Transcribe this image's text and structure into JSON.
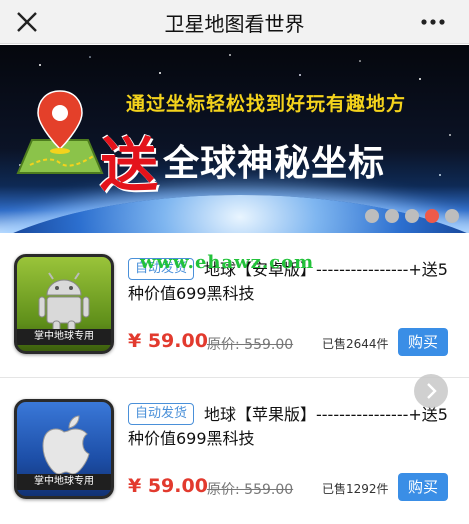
{
  "header": {
    "title": "卫星地图看世界",
    "close_icon": "close-icon",
    "more_icon": "more-dots-icon"
  },
  "banner": {
    "subtitle": "通过坐标轻松找到好玩有趣地方",
    "headline_highlight": "送",
    "headline_rest": "全球神秘坐标",
    "dots": 5,
    "active_dot": 4,
    "colors": {
      "highlight": "#e4131b",
      "subtitle": "#f4d31c",
      "active_dot": "#ee5a4a"
    }
  },
  "watermark": "www.ehawz.com",
  "products": [
    {
      "tag": "自动发货",
      "title": "地球【安卓版】----------------+送5种价值699黑科技",
      "thumb_label": "掌中地球专用",
      "price": "¥ 59.00",
      "original_price": "原价: 559.00",
      "sold": "已售2644件",
      "buy_label": "购买",
      "icon": "android-icon"
    },
    {
      "tag": "自动发货",
      "title": "地球【苹果版】----------------+送5种价值699黑科技",
      "thumb_label": "掌中地球专用",
      "price": "¥ 59.00",
      "original_price": "原价: 559.00",
      "sold": "已售1292件",
      "buy_label": "购买",
      "icon": "apple-icon"
    }
  ],
  "colors": {
    "price": "#e23a2e",
    "buy_button": "#3a8ee6",
    "tag": "#4a90d9"
  }
}
